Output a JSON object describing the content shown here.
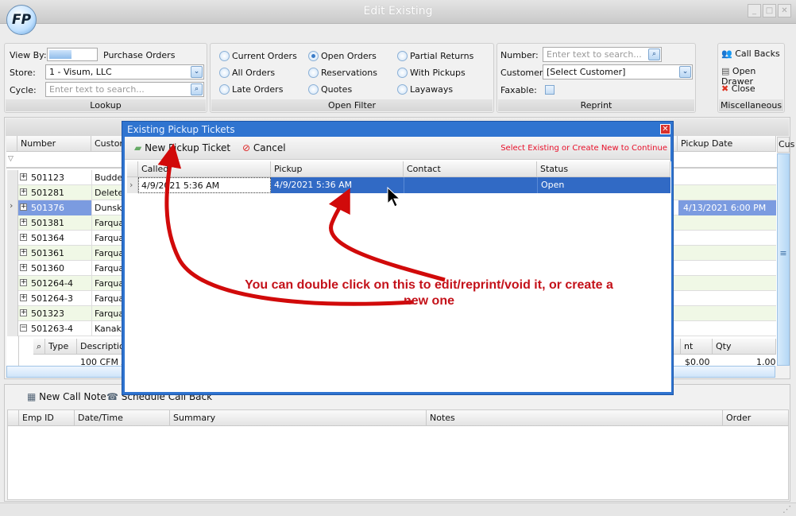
{
  "window": {
    "title": "Edit Existing",
    "logo_text": "FP",
    "min": "_",
    "max": "□",
    "close": "✕"
  },
  "lookup": {
    "caption": "Lookup",
    "view_by_label": "View By:",
    "view_by_value": "Purchase Orders",
    "store_label": "Store:",
    "store_value": "1 - Visum, LLC",
    "cycle_label": "Cycle:",
    "cycle_placeholder": "Enter text to search..."
  },
  "open_filter": {
    "caption": "Open Filter",
    "options": [
      {
        "label": "Current Orders",
        "selected": false
      },
      {
        "label": "Open Orders",
        "selected": true
      },
      {
        "label": "Partial Returns",
        "selected": false
      },
      {
        "label": "All Orders",
        "selected": false
      },
      {
        "label": "Reservations",
        "selected": false
      },
      {
        "label": "With Pickups",
        "selected": false
      },
      {
        "label": "Late Orders",
        "selected": false
      },
      {
        "label": "Quotes",
        "selected": false
      },
      {
        "label": "Layaways",
        "selected": false
      }
    ]
  },
  "reprint": {
    "caption": "Reprint",
    "number_label": "Number:",
    "number_placeholder": "Enter text to search...",
    "customer_label": "Customer:",
    "customer_value": "[Select Customer]",
    "faxable_label": "Faxable:"
  },
  "misc": {
    "caption": "Miscellaneous",
    "call_backs": "Call Backs",
    "open_drawer": "Open Drawer",
    "close": "Close"
  },
  "grid": {
    "columns": {
      "number": "Number",
      "customer": "Customer",
      "pickup_date": "Pickup Date",
      "cus": "Cus"
    },
    "rows": [
      {
        "number": "501123",
        "customer": "Budde,"
      },
      {
        "number": "501281",
        "customer": "Deleted"
      },
      {
        "number": "501376",
        "customer": "Dunski,",
        "pickup_date": "4/13/2021 6:00 PM",
        "selected": true
      },
      {
        "number": "501381",
        "customer": "Farqua"
      },
      {
        "number": "501364",
        "customer": "Farqua"
      },
      {
        "number": "501361",
        "customer": "Farqua"
      },
      {
        "number": "501360",
        "customer": "Farqua"
      },
      {
        "number": "501264-4",
        "customer": "Farqua"
      },
      {
        "number": "501264-3",
        "customer": "Farqua"
      },
      {
        "number": "501323",
        "customer": "Farqua"
      },
      {
        "number": "501263-4",
        "customer": "Kanak,",
        "expanded": true
      }
    ],
    "detail": {
      "columns": {
        "type": "Type",
        "description": "Description",
        "amount": "nt",
        "qty": "Qty"
      },
      "row": {
        "description": "100 CFM A",
        "amount": "$0.00",
        "qty": "1.00"
      }
    }
  },
  "callnotes": {
    "new_call_note": "New Call Note",
    "schedule_call_back": "Schedule Call Back",
    "columns": {
      "emp_id": "Emp ID",
      "date_time": "Date/Time",
      "summary": "Summary",
      "notes": "Notes",
      "order": "Order"
    }
  },
  "dialog": {
    "title": "Existing Pickup Tickets",
    "new_ticket": "New Pickup Ticket",
    "cancel": "Cancel",
    "hint": "Select Existing or Create New to Continue",
    "hint_color": "#e8102a",
    "columns": {
      "called": "Called",
      "pickup": "Pickup",
      "contact": "Contact",
      "status": "Status"
    },
    "rows": [
      {
        "called": "4/9/2021 5:36 AM",
        "pickup": "4/9/2021 5:36 AM",
        "contact": "",
        "status": "Open"
      }
    ]
  },
  "annotation": {
    "line1": "You can double click on this to edit/reprint/void it, or create a",
    "line2": "new one",
    "color": "#c4121a"
  }
}
